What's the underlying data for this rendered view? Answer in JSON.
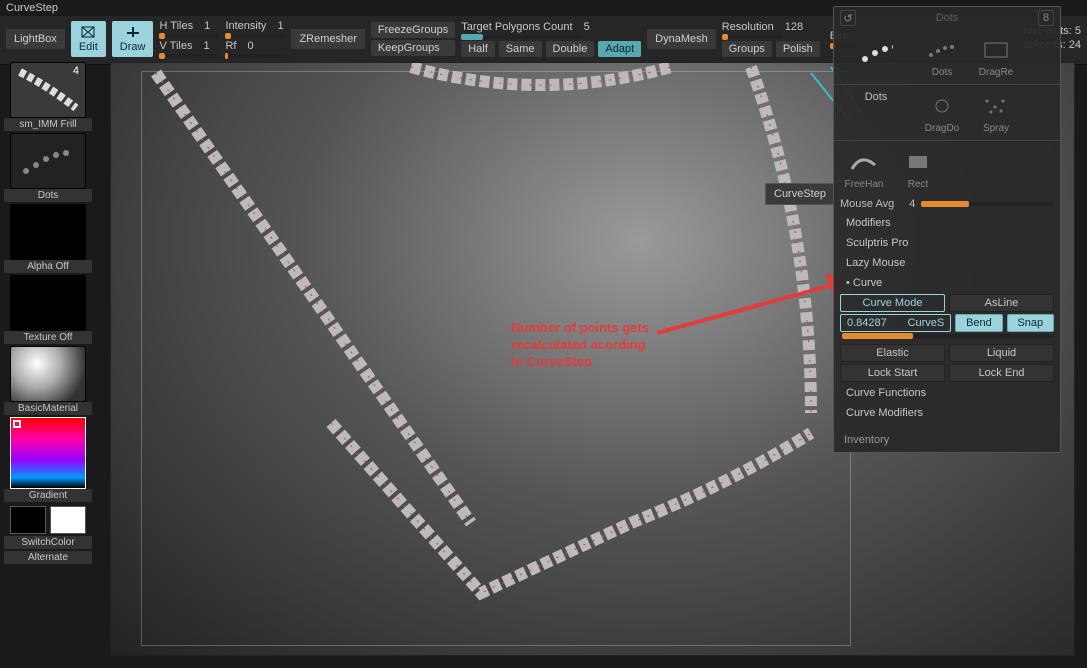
{
  "title_bar": "CurveStep",
  "topbar": {
    "lightbox": "LightBox",
    "edit": "Edit",
    "draw": "Draw",
    "htiles": {
      "label": "H Tiles",
      "value": "1"
    },
    "vtiles": {
      "label": "V Tiles",
      "value": "1"
    },
    "intensity": {
      "label": "Intensity",
      "value": "1"
    },
    "rf": {
      "label": "Rf",
      "value": "0"
    },
    "zremesher": "ZRemesher",
    "freeze_groups": "FreezeGroups",
    "keep_groups": "KeepGroups",
    "target_polys": {
      "label": "Target Polygons Count",
      "value": "5"
    },
    "half": "Half",
    "same": "Same",
    "double": "Double",
    "adapt": "Adapt",
    "dynamesh": "DynaMesh",
    "resolution": {
      "label": "Resolution",
      "value": "128"
    },
    "groups": "Groups",
    "polish": "Polish",
    "blur": "Blur"
  },
  "stats": {
    "active_points": "ivePoints: 5",
    "total_points": "alPoints: 24"
  },
  "left": {
    "brush_badge": "4",
    "brush_name": "sm_IMM Frill",
    "stroke_name": "Dots",
    "alpha_off": "Alpha Off",
    "texture_off": "Texture Off",
    "material_name": "BasicMaterial",
    "gradient": "Gradient",
    "switch_color": "SwitchColor",
    "alternate": "Alternate"
  },
  "viewport": {
    "tooltip": "CurveStep",
    "annotation_line1": "Number of points gets",
    "annotation_line2": "recalculated acording",
    "annotation_line3": "to CurveStep"
  },
  "panel": {
    "header_label": "Dots",
    "header_badge": "8",
    "icons_top": {
      "dots": "Dots",
      "dragre": "DragRe"
    },
    "icons_mid": {
      "dots": "Dots",
      "dragdo": "DragDo",
      "spray": "Spray"
    },
    "icons_bot": {
      "freehand": "FreeHan",
      "rect": "Rect"
    },
    "mouse_avg": {
      "label": "Mouse Avg",
      "value": "4"
    },
    "modifiers": "Modifiers",
    "sculptris": "Sculptris Pro",
    "lazy_mouse": "Lazy Mouse",
    "curve": "Curve",
    "curve_mode": "Curve Mode",
    "as_line": "AsLine",
    "curvestep_value": "0.84287",
    "curvestep_label": "CurveS",
    "bend": "Bend",
    "snap": "Snap",
    "elastic": "Elastic",
    "liquid": "Liquid",
    "lock_start": "Lock Start",
    "lock_end": "Lock End",
    "curve_functions": "Curve Functions",
    "curve_modifiers": "Curve Modifiers",
    "inventory": "Inventory"
  },
  "colors": {
    "accent": "#9bd3dd",
    "orange": "#e58a2e",
    "redArrow": "#e23c3c"
  }
}
